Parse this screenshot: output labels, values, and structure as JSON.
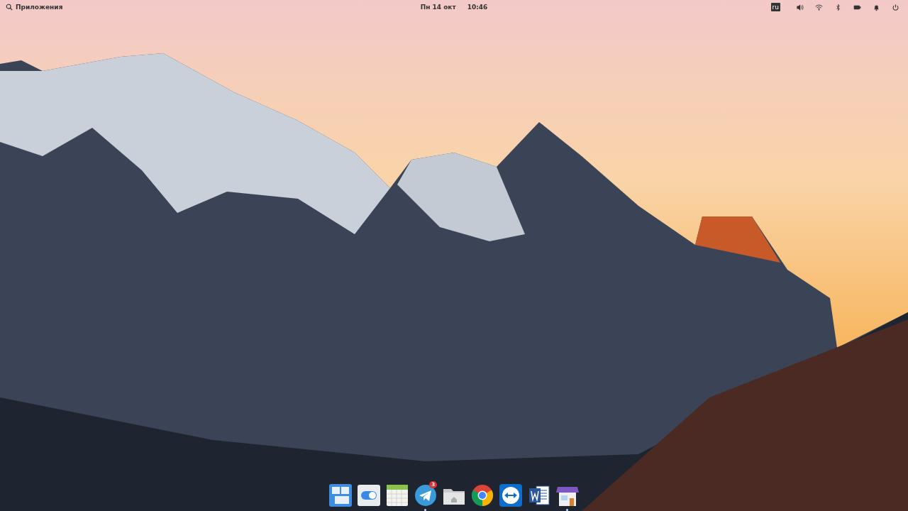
{
  "panel": {
    "applications_menu": "Приложения",
    "date": "Пн 14 окт",
    "time": "10:46",
    "indicators": [
      {
        "kind": "keyboard",
        "label": "ru"
      },
      {
        "kind": "volume"
      },
      {
        "kind": "wifi"
      },
      {
        "kind": "bluetooth"
      },
      {
        "kind": "battery"
      },
      {
        "kind": "notifications"
      },
      {
        "kind": "power"
      }
    ]
  },
  "dock": {
    "items": [
      {
        "kind": "multitasking",
        "running": false
      },
      {
        "kind": "settings",
        "running": false
      },
      {
        "kind": "calendar",
        "running": false
      },
      {
        "kind": "telegram",
        "running": true,
        "badge": "3"
      },
      {
        "kind": "files",
        "running": false
      },
      {
        "kind": "chrome",
        "running": false
      },
      {
        "kind": "teamviewer",
        "running": false
      },
      {
        "kind": "word",
        "running": false
      },
      {
        "kind": "store",
        "running": true
      }
    ]
  }
}
